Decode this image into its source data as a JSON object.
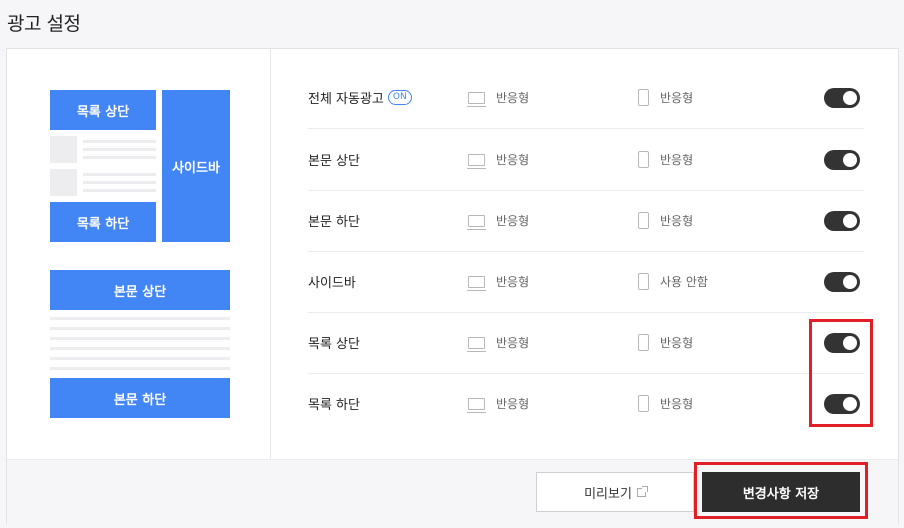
{
  "page": {
    "title": "광고 설정"
  },
  "layout_preview": {
    "list_top": "목록 상단",
    "list_bottom": "목록 하단",
    "sidebar": "사이드바",
    "body_top": "본문 상단",
    "body_bottom": "본문 하단"
  },
  "rows": [
    {
      "label": "전체 자동광고",
      "badge": "ON",
      "pc": "반응형",
      "mobile": "반응형",
      "enabled": true
    },
    {
      "label": "본문 상단",
      "pc": "반응형",
      "mobile": "반응형",
      "enabled": true
    },
    {
      "label": "본문 하단",
      "pc": "반응형",
      "mobile": "반응형",
      "enabled": true
    },
    {
      "label": "사이드바",
      "pc": "반응형",
      "mobile": "사용 안함",
      "enabled": true
    },
    {
      "label": "목록 상단",
      "pc": "반응형",
      "mobile": "반응형",
      "enabled": true
    },
    {
      "label": "목록 하단",
      "pc": "반응형",
      "mobile": "반응형",
      "enabled": true
    }
  ],
  "footer": {
    "preview_label": "미리보기",
    "save_label": "변경사항 저장"
  },
  "colors": {
    "accent_blue": "#4285f4",
    "toggle_on": "#333333",
    "save_button": "#2d2d2d",
    "highlight": "#e01f26"
  }
}
